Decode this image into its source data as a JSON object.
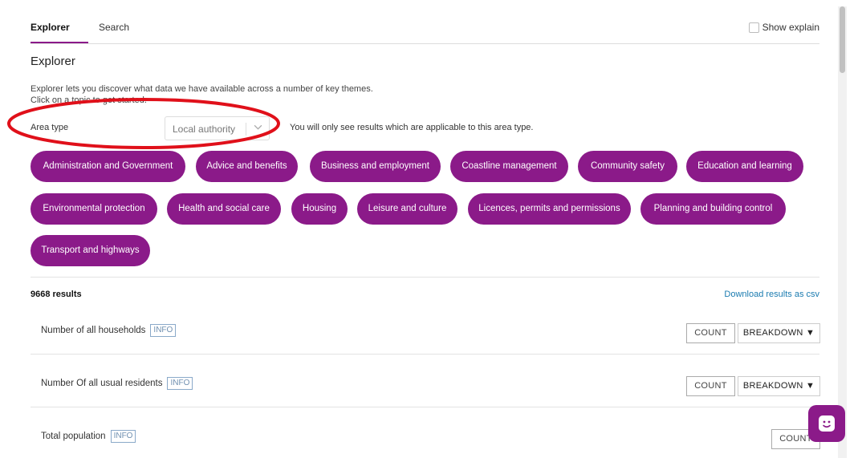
{
  "tabs": {
    "explorer": "Explorer",
    "search": "Search"
  },
  "show_explain": "Show explain",
  "page_title": "Explorer",
  "intro": {
    "line1": "Explorer lets you discover what data we have available across a number of key themes.",
    "line2": "Click on a topic to get started."
  },
  "area_type": {
    "label": "Area type",
    "value": "Local authority",
    "note": "You will only see results which are applicable to this area type."
  },
  "topics": [
    "Administration and Government",
    "Advice and benefits",
    "Business and employment",
    "Coastline management",
    "Community safety",
    "Education and learning",
    "Environmental protection",
    "Health and social care",
    "Housing",
    "Leisure and culture",
    "Licences, permits and permissions",
    "Planning and building control",
    "Transport and highways"
  ],
  "results": {
    "count_label": "9668 results",
    "download_label": "Download results as csv",
    "info_label": "INFO",
    "count_button": "COUNT",
    "breakdown_button": "BREAKDOWN ▼",
    "rows": [
      {
        "label": "Number of all households"
      },
      {
        "label": "Number Of all usual residents"
      },
      {
        "label": "Total population"
      }
    ]
  },
  "colors": {
    "accent": "#8b1a89",
    "link": "#1a7bb0",
    "annotation": "#e0101a"
  },
  "icons": {
    "chat": "chat-face-icon",
    "dropdown": "chevron-down-icon"
  }
}
